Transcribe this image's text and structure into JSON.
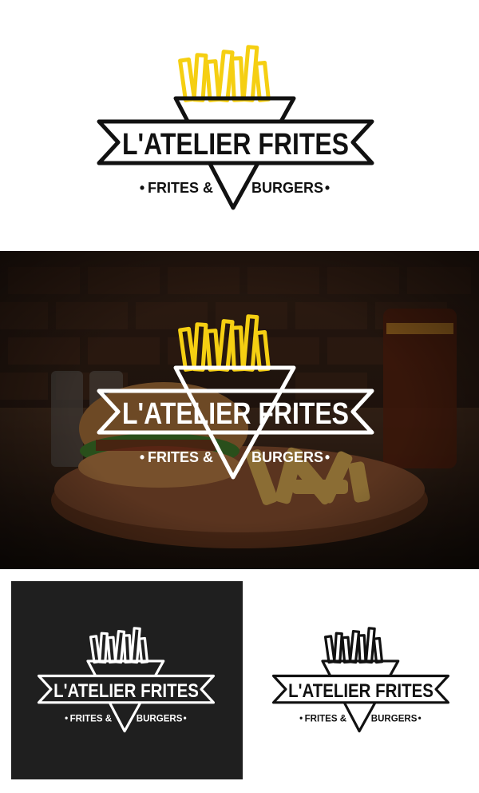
{
  "brand": {
    "name": "L'ATELIER FRITES",
    "tagline_left": "FRITES &",
    "tagline_right": "BURGERS",
    "bullet": "•"
  },
  "colors": {
    "fries_yellow": "#f5cf12",
    "ink_black": "#111111",
    "paper_white": "#ffffff",
    "dark_panel": "#1f1f1f"
  },
  "variants": [
    {
      "id": "color-on-white",
      "fries": "yellow",
      "ink": "black",
      "background": "white"
    },
    {
      "id": "on-photo",
      "fries": "yellow",
      "ink": "white",
      "background": "burger photo"
    },
    {
      "id": "white-on-dark",
      "fries": "white",
      "ink": "white",
      "background": "dark"
    },
    {
      "id": "black-on-white",
      "fries": "outline",
      "ink": "black",
      "background": "white"
    }
  ]
}
